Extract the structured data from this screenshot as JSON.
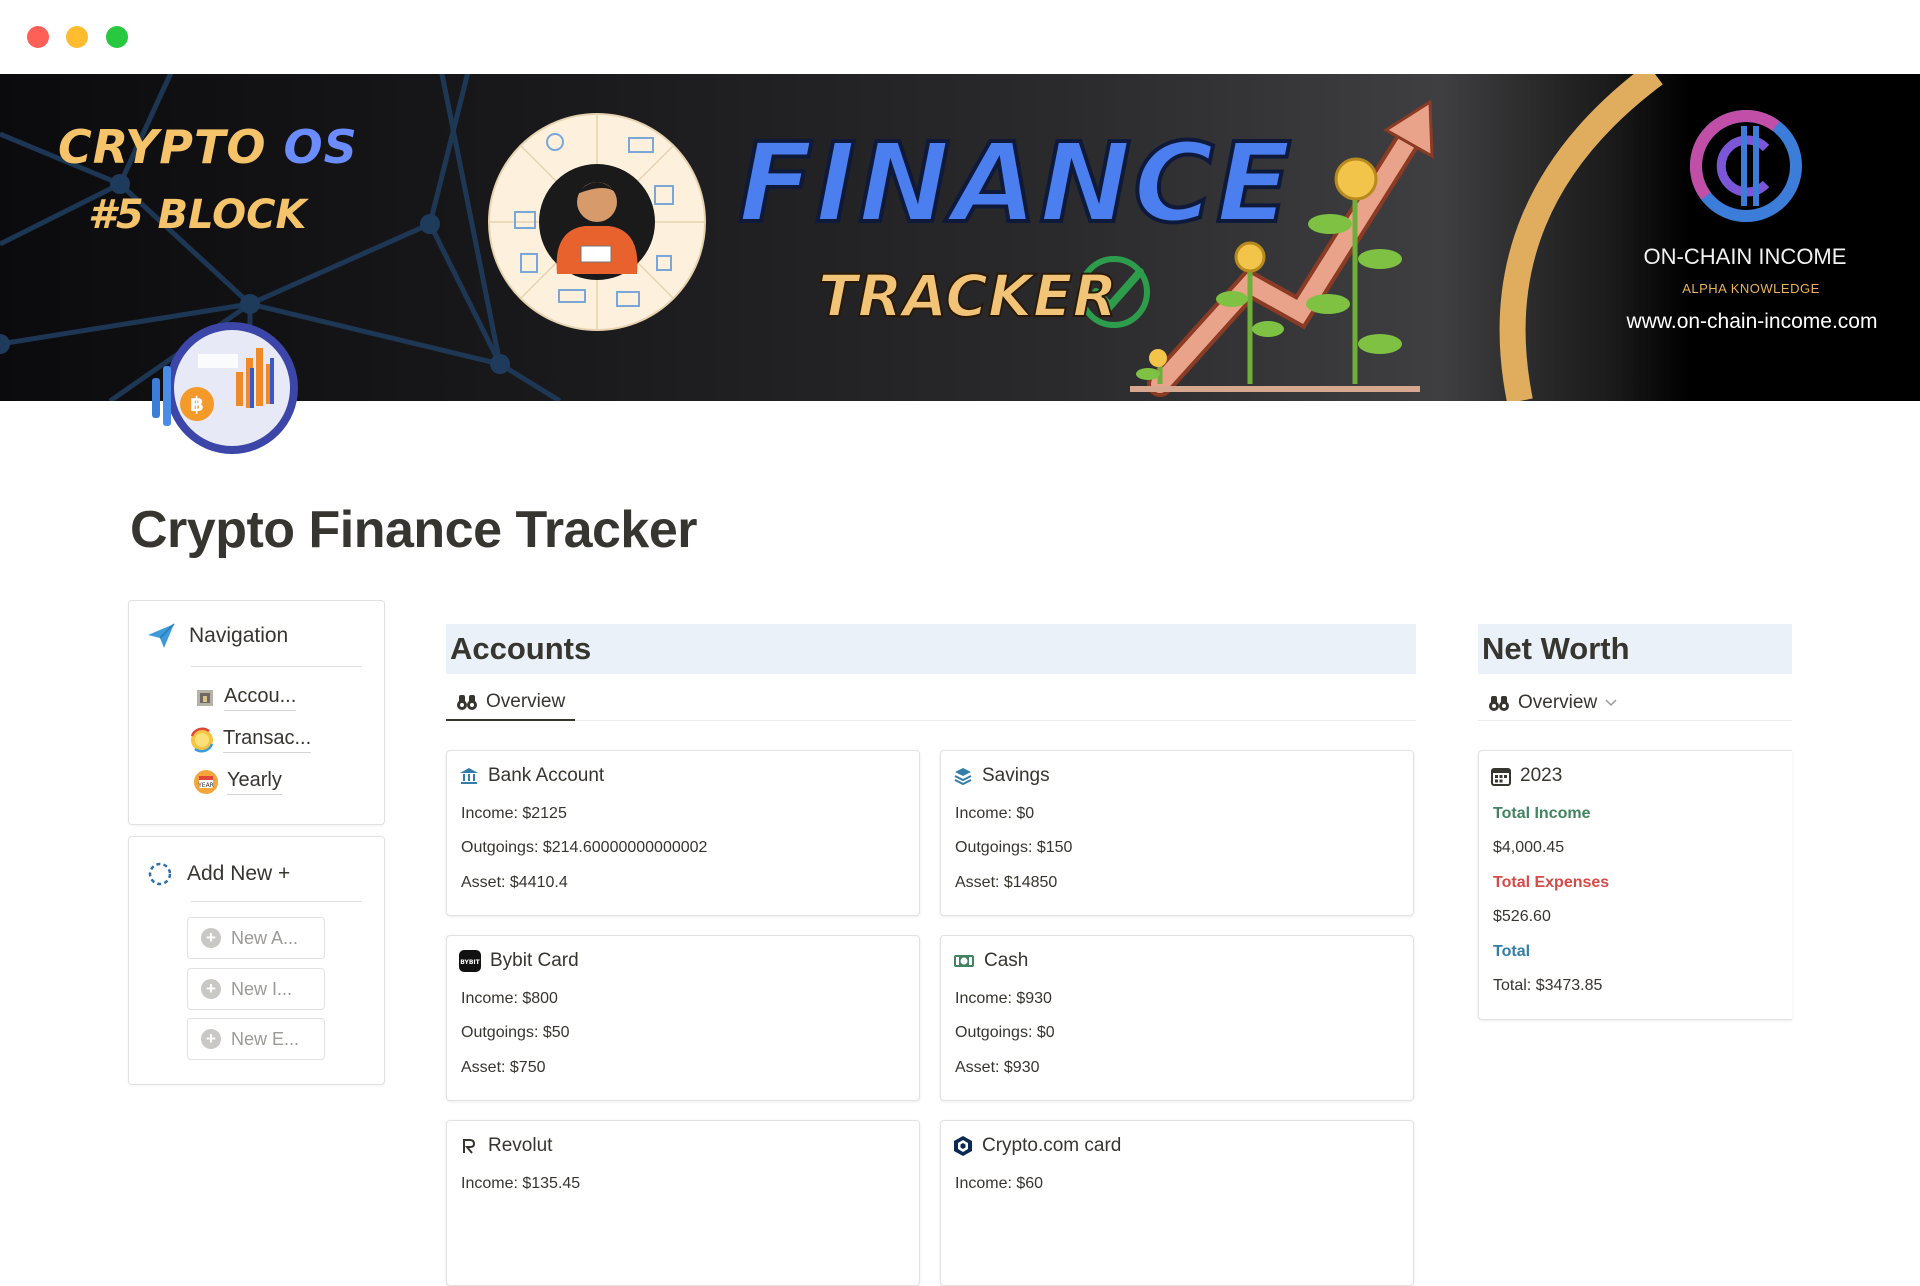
{
  "window": {
    "controls": [
      "close",
      "minimize",
      "maximize"
    ]
  },
  "banner": {
    "crypto_word": "CRYPTO",
    "os_word": "OS",
    "block_label": "#5 BLOCK",
    "finance_word": "FINANCE",
    "tracker_word": "TRACKER",
    "brand_name": "ON-CHAIN INCOME",
    "brand_tagline": "ALPHA KNOWLEDGE",
    "brand_url": "www.on-chain-income.com",
    "accent_blue": "#4b7ff0",
    "accent_gold": "#f2c477"
  },
  "page": {
    "title": "Crypto Finance Tracker"
  },
  "navigation": {
    "title": "Navigation",
    "items": [
      {
        "label": "Accou...",
        "icon": "bank-building-icon"
      },
      {
        "label": "Transac...",
        "icon": "coin-exchange-icon"
      },
      {
        "label": "Yearly",
        "icon": "calendar-icon"
      }
    ]
  },
  "add_new": {
    "title": "Add New +",
    "buttons": [
      {
        "label": "New A..."
      },
      {
        "label": "New I..."
      },
      {
        "label": "New E..."
      }
    ]
  },
  "accounts": {
    "title": "Accounts",
    "view_tab": "Overview",
    "cards": [
      {
        "name": "Bank Account",
        "icon": "bank-icon",
        "income": "Income: $2125",
        "outgoings": "Outgoings: $214.60000000000002",
        "asset": "Asset: $4410.4"
      },
      {
        "name": "Savings",
        "icon": "layers-icon",
        "income": "Income: $0",
        "outgoings": "Outgoings: $150",
        "asset": "Asset: $14850"
      },
      {
        "name": "Bybit Card",
        "icon": "bybit-icon",
        "income": "Income: $800",
        "outgoings": "Outgoings: $50",
        "asset": "Asset: $750"
      },
      {
        "name": "Cash",
        "icon": "cash-icon",
        "income": "Income: $930",
        "outgoings": "Outgoings: $0",
        "asset": "Asset: $930"
      },
      {
        "name": "Revolut",
        "icon": "revolut-icon",
        "income": "Income: $135.45",
        "outgoings": "",
        "asset": ""
      },
      {
        "name": "Crypto.com card",
        "icon": "crypto-com-icon",
        "income": "Income: $60",
        "outgoings": "",
        "asset": ""
      }
    ]
  },
  "net_worth": {
    "title": "Net Worth",
    "view_tab": "Overview",
    "year": "2023",
    "total_income_label": "Total Income",
    "total_income_value": "$4,000.45",
    "total_expenses_label": "Total Expenses",
    "total_expenses_value": "$526.60",
    "total_label": "Total",
    "total_value": "Total: $3473.85",
    "colors": {
      "income": "#448361",
      "expenses": "#d44c47",
      "total": "#337ea9"
    }
  }
}
